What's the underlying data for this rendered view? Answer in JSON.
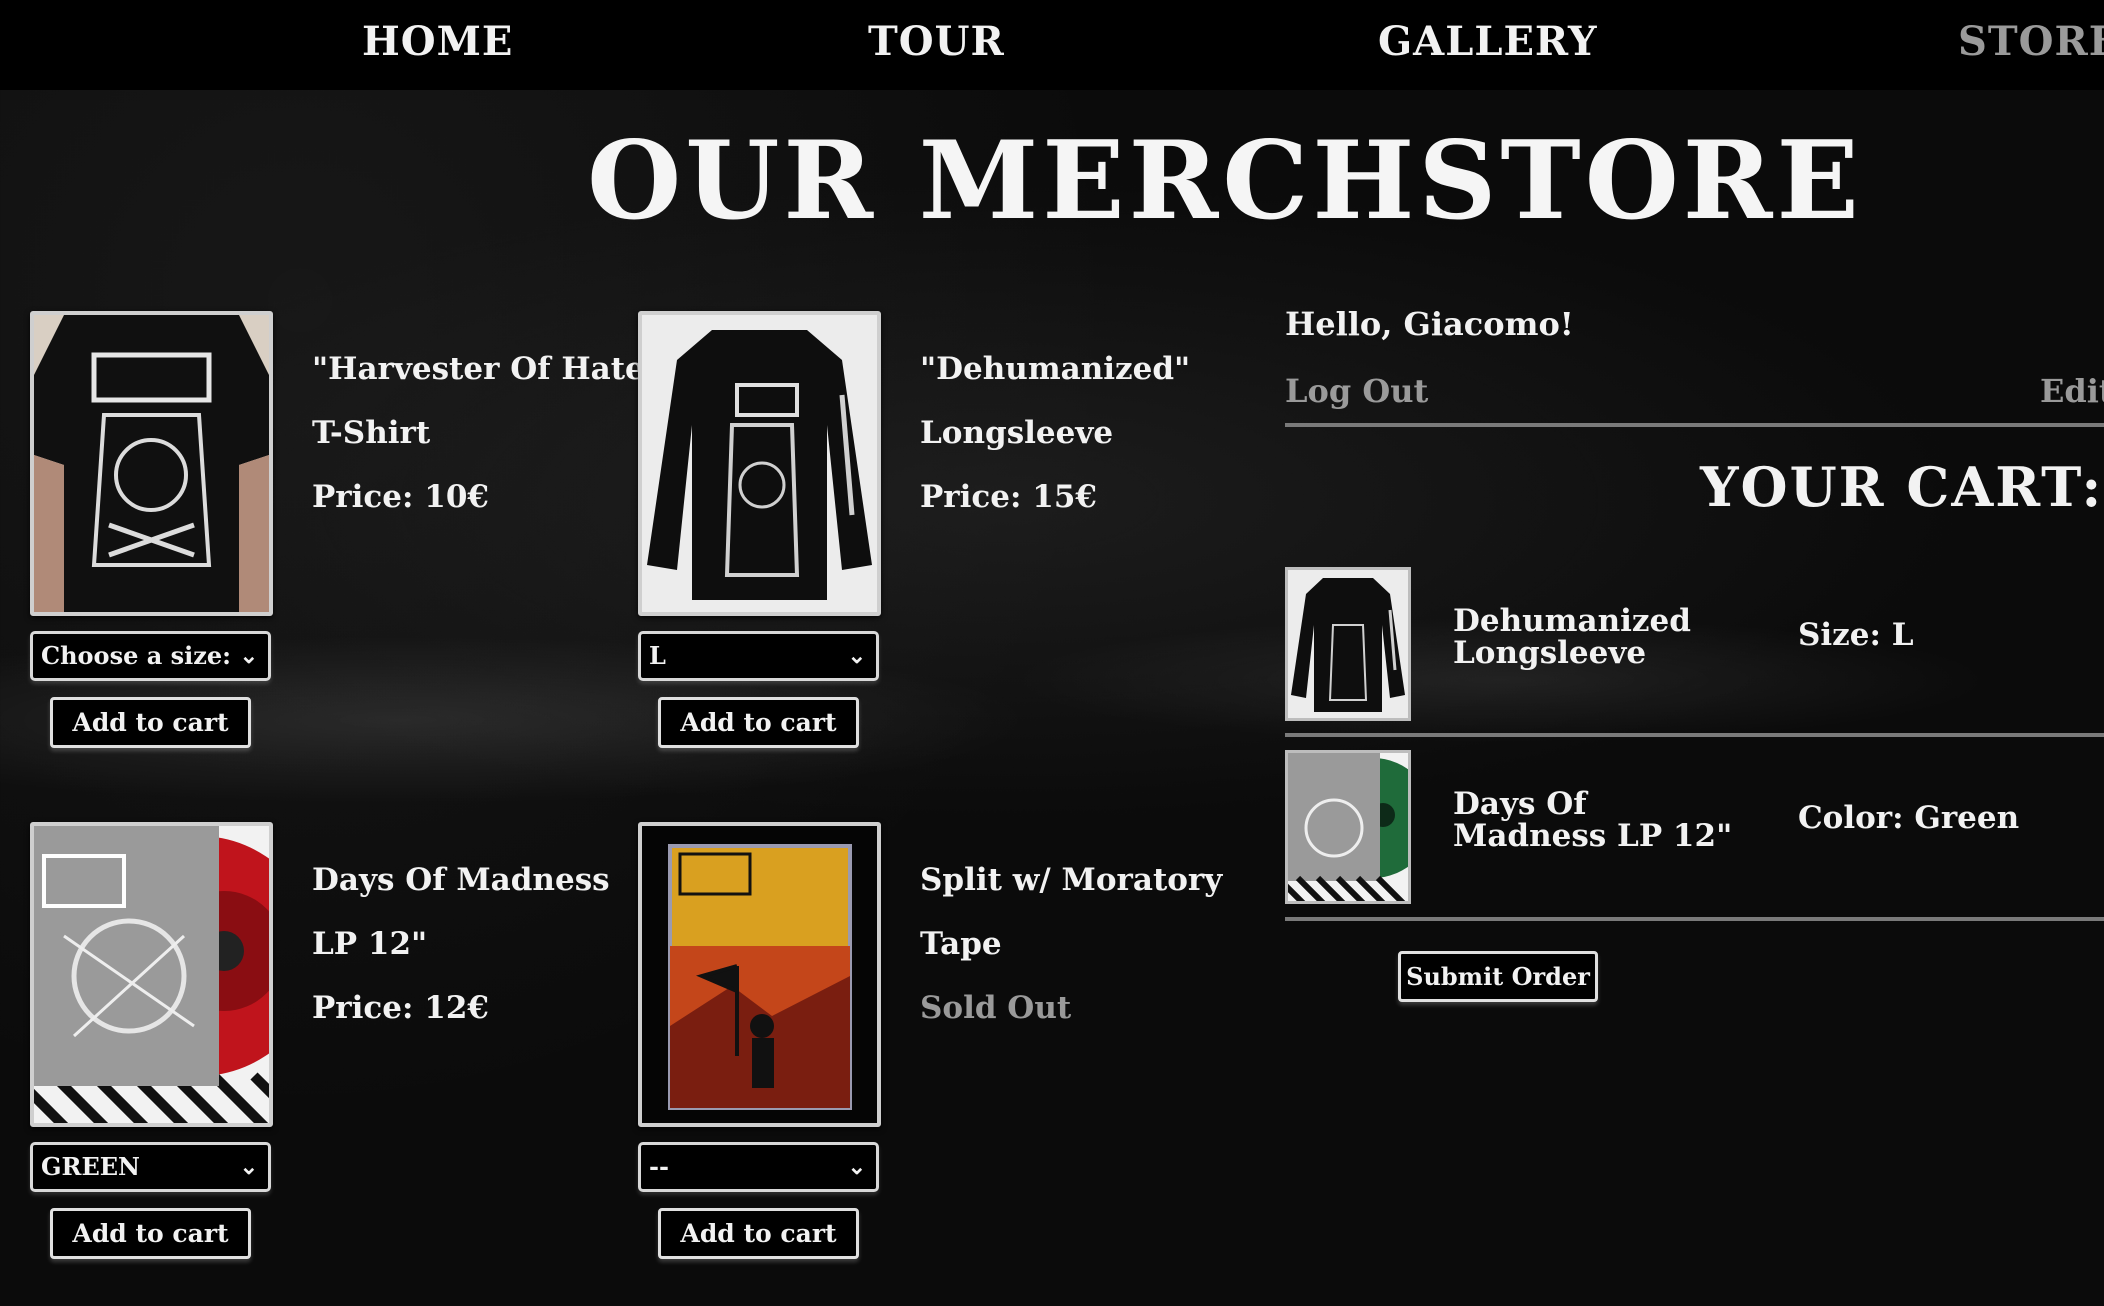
{
  "nav": {
    "items": [
      {
        "label": "HOME",
        "active": false
      },
      {
        "label": "TOUR",
        "active": false
      },
      {
        "label": "GALLERY",
        "active": false
      },
      {
        "label": "STORE",
        "active": true
      }
    ]
  },
  "page": {
    "title": "OUR MERCHSTORE"
  },
  "products": [
    {
      "name": "\"Harvester Of Hate\"",
      "type": "T-Shirt",
      "price": "Price: 10€",
      "select_value": "Choose a size:",
      "button": "Add to cart"
    },
    {
      "name": "\"Dehumanized\"",
      "type": "Longsleeve",
      "price": "Price: 15€",
      "select_value": "L",
      "button": "Add to cart"
    },
    {
      "name": "Days Of Madness",
      "type": "LP 12\"",
      "price": "Price: 12€",
      "select_value": "GREEN",
      "button": "Add to cart"
    },
    {
      "name": "Split w/ Moratory",
      "type": "Tape",
      "price": "Sold Out",
      "select_value": "--",
      "button": "Add to cart"
    }
  ],
  "user": {
    "greeting": "Hello, Giacomo!",
    "logout": "Log Out",
    "edit": "Edit"
  },
  "cart": {
    "title": "YOUR CART:",
    "items": [
      {
        "name": "Dehumanized Longsleeve",
        "option": "Size: L"
      },
      {
        "name": "Days Of Madness LP 12\"",
        "option": "Color: Green"
      }
    ],
    "submit": "Submit Order"
  },
  "colors": {
    "background": "#0b0b0b",
    "text": "#f2f2f2",
    "muted": "#9a9a9a",
    "lp_red": "#c0141c",
    "lp_green": "#1f6b3a"
  }
}
